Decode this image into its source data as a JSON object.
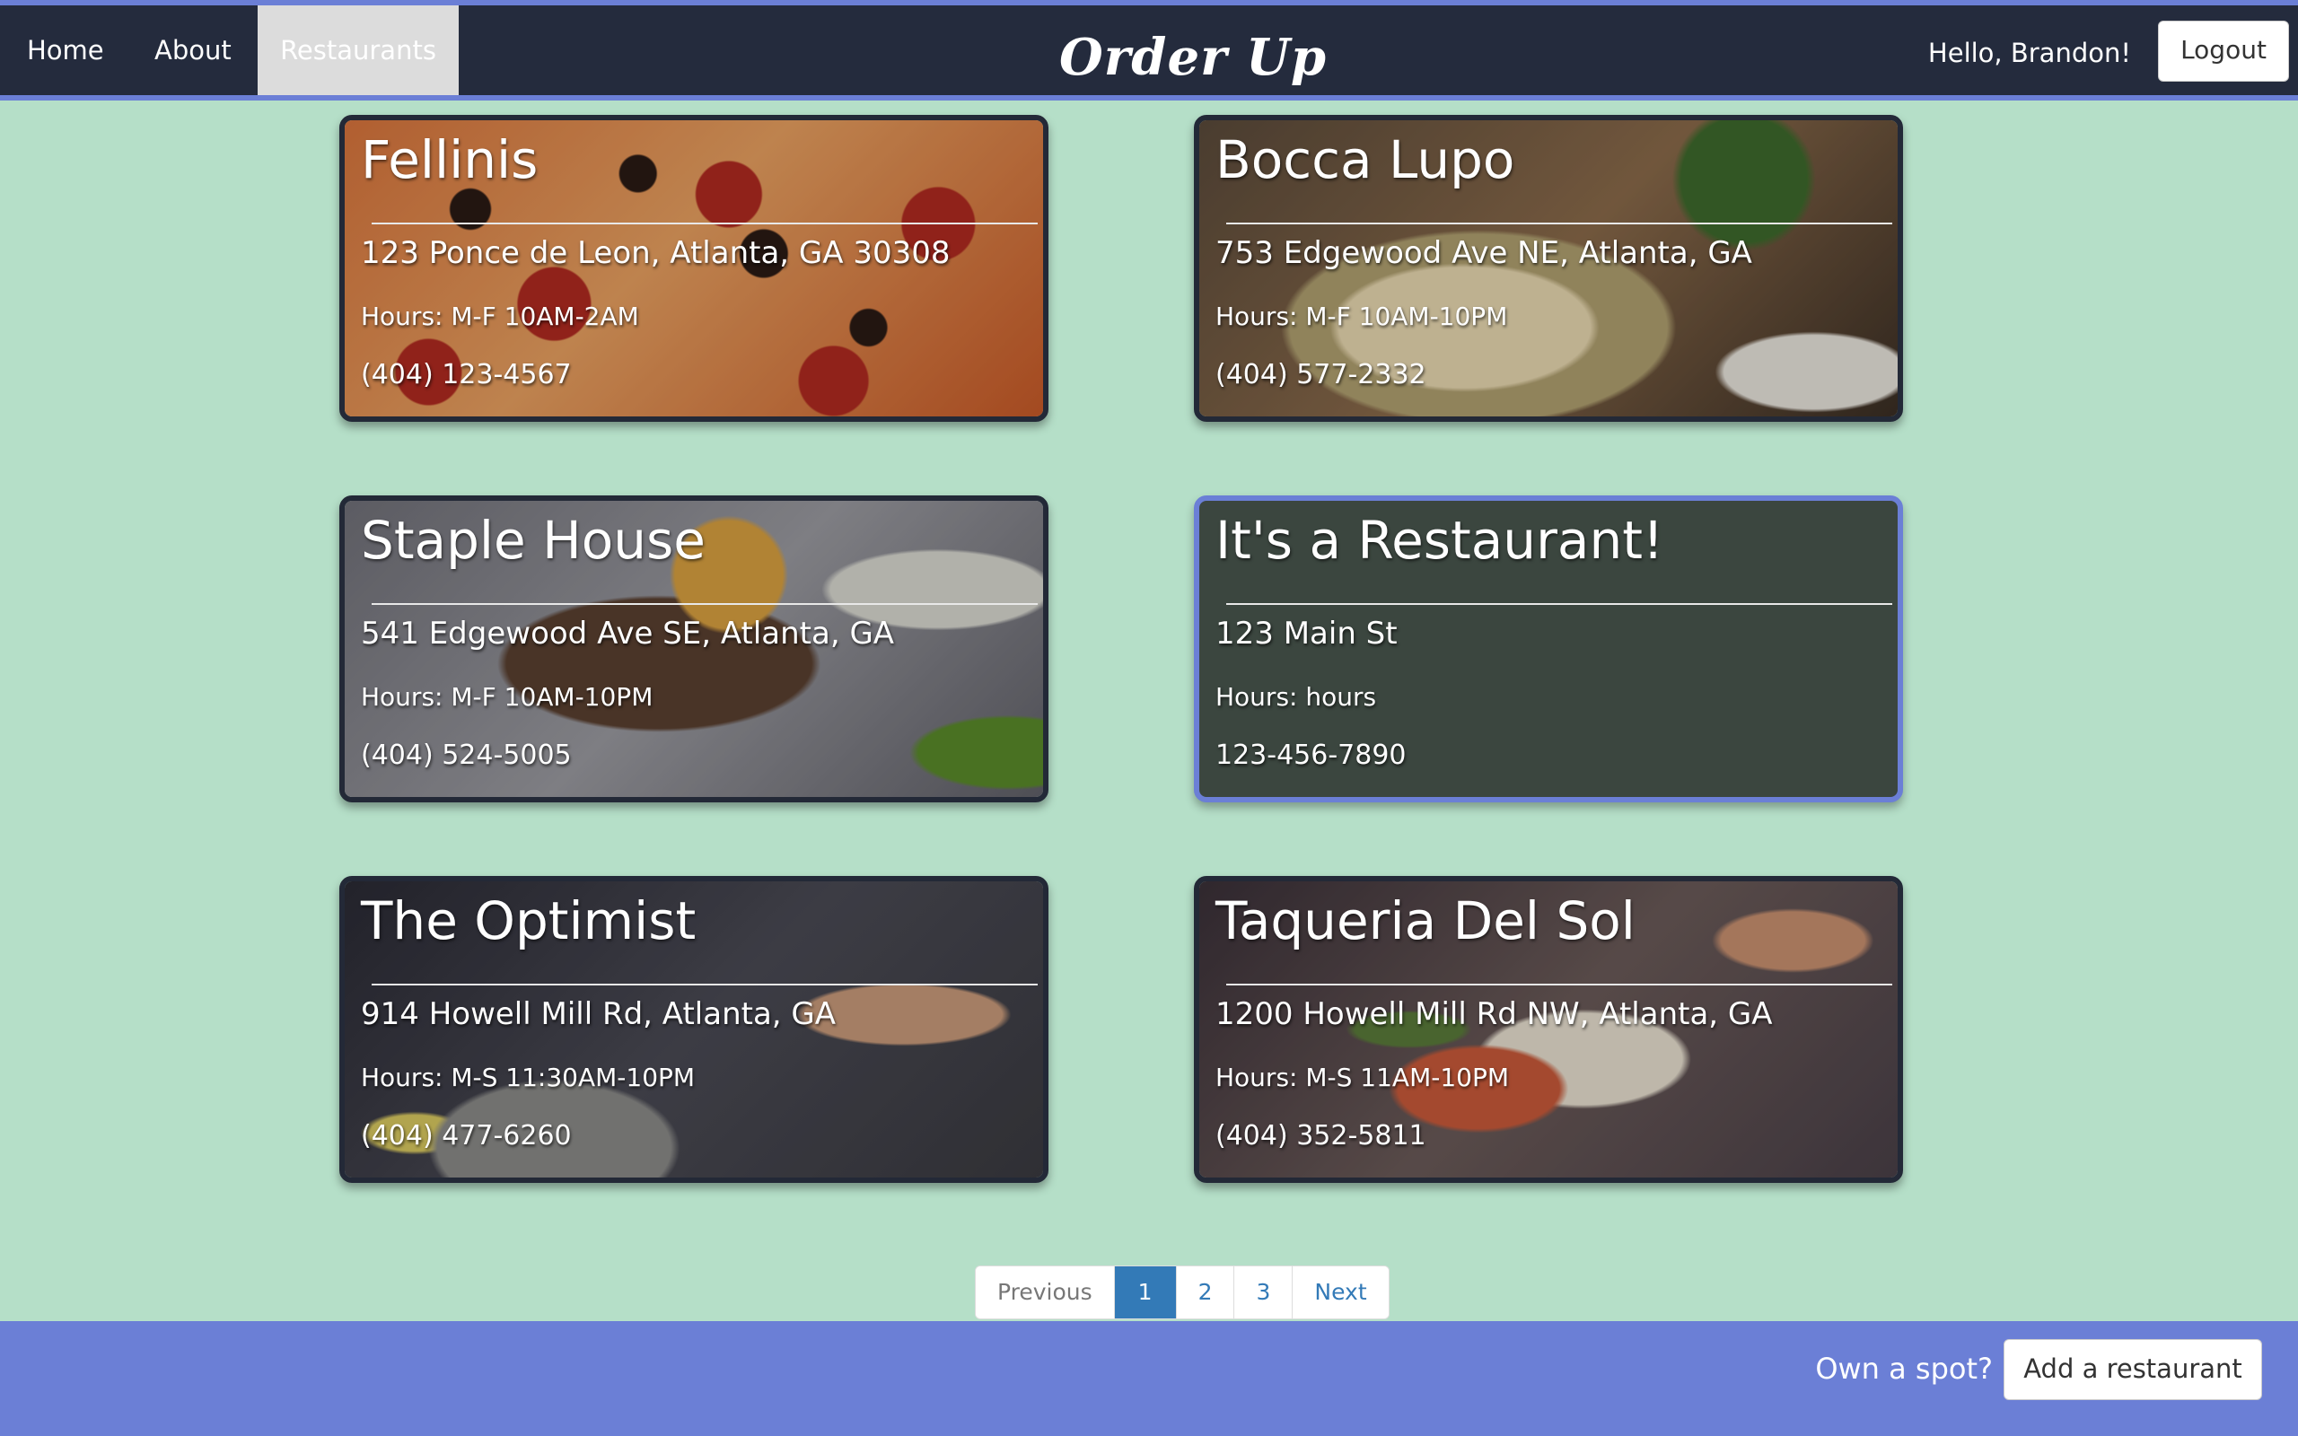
{
  "nav": {
    "home": "Home",
    "about": "About",
    "restaurants": "Restaurants",
    "brand": "Order Up",
    "greeting": "Hello, Brandon!",
    "logout": "Logout"
  },
  "restaurants": [
    {
      "name": "Fellinis",
      "address": "123 Ponce de Leon, Atlanta, GA 30308",
      "hours": "Hours: M-F 10AM-2AM",
      "phone": "(404) 123-4567"
    },
    {
      "name": "Bocca Lupo",
      "address": "753 Edgewood Ave NE, Atlanta, GA",
      "hours": "Hours: M-F 10AM-10PM",
      "phone": "(404) 577-2332"
    },
    {
      "name": "Staple House",
      "address": "541 Edgewood Ave SE, Atlanta, GA",
      "hours": "Hours: M-F 10AM-10PM",
      "phone": "(404) 524-5005"
    },
    {
      "name": "It's a Restaurant!",
      "address": "123 Main St",
      "hours": "Hours: hours",
      "phone": "123-456-7890"
    },
    {
      "name": "The Optimist",
      "address": "914 Howell Mill Rd, Atlanta, GA",
      "hours": "Hours: M-S 11:30AM-10PM",
      "phone": "(404) 477-6260"
    },
    {
      "name": "Taqueria Del Sol",
      "address": "1200 Howell Mill Rd NW, Atlanta, GA",
      "hours": "Hours: M-S 11AM-10PM",
      "phone": "(404) 352-5811"
    }
  ],
  "pagination": {
    "previous": "Previous",
    "pages": [
      "1",
      "2",
      "3"
    ],
    "next": "Next",
    "current_page": 1
  },
  "footer": {
    "prompt": "Own a spot?",
    "add_button": "Add a restaurant"
  },
  "colors": {
    "background": "#b5dfc8",
    "navbar": "#242b3d",
    "accent": "#6b7fd6",
    "active_page": "#337ab7"
  }
}
